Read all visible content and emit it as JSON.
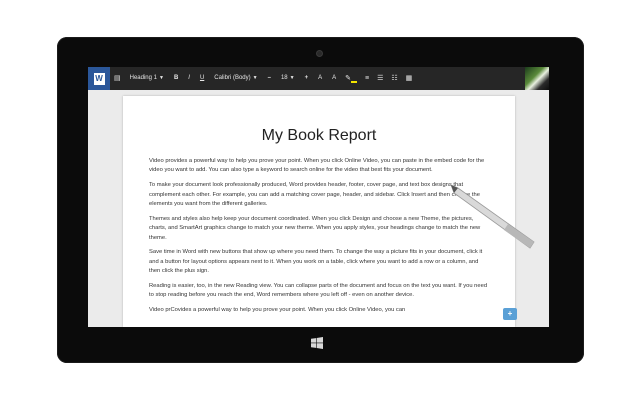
{
  "toolbar": {
    "app_letter": "W",
    "style_value": "Heading 1",
    "bold": "B",
    "italic": "I",
    "underline": "U",
    "font_value": "Calibri (Body)",
    "shrink": "–",
    "font_size": "18",
    "grow": "+",
    "font_color": "A",
    "clear_format": "A",
    "highlight_color": "#f2e400",
    "icons": [
      "clipboard-icon",
      "bold-icon",
      "italic-icon",
      "underline-icon",
      "decrease-font-icon",
      "increase-font-icon",
      "font-color-icon",
      "clear-formatting-icon",
      "highlighter-icon",
      "align-icon",
      "bullets-icon",
      "numbering-icon",
      "indent-icon"
    ]
  },
  "document": {
    "title": "My Book Report",
    "paragraphs": [
      "Video provides a powerful way to help you prove your point. When you click Online Video, you can paste in the embed code for the video you want to add. You can also type a keyword to search online for the video that best fits your document.",
      "To make your document look professionally produced, Word provides header, footer, cover page, and text box designs that complement each other. For example, you can add a matching cover page, header, and sidebar. Click Insert and then choose the elements you want from the different galleries.",
      "Themes and styles also help keep your document coordinated. When you click Design and choose a new Theme, the pictures, charts, and SmartArt graphics change to match your new theme. When you apply styles, your headings change to match the new theme.",
      "Save time in Word with new buttons that show up where you need them. To change the way a picture fits in your document, click it and a button for layout options appears next to it. When you work on a table, click where you want to add a row or a column, and then click the plus sign.",
      "Reading is easier, too, in the new Reading view. You can collapse parts of the document and focus on the text you want. If you need to stop reading before you reach the end, Word remembers where you left off - even on another device.",
      "Video prCovides a powerful way to help you prove your point. When you click Online Video, you can"
    ]
  },
  "colors": {
    "accent": "#2b579a",
    "ribbon": "#262626",
    "bezel": "#0b0b0b",
    "chip": "#5aa0d6"
  }
}
